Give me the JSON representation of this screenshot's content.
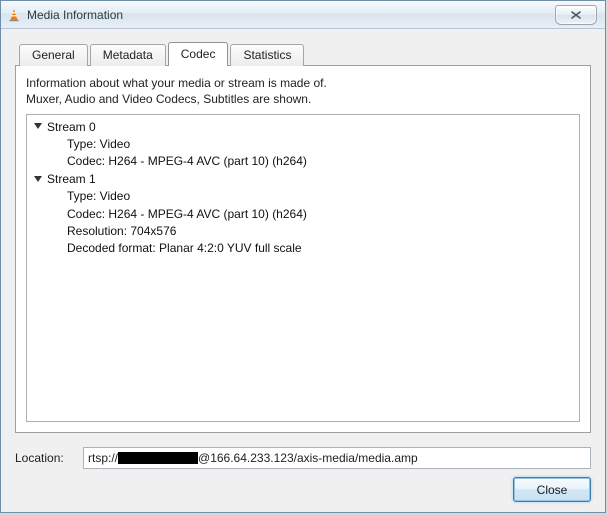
{
  "window": {
    "title": "Media Information"
  },
  "tabs": {
    "general": "General",
    "metadata": "Metadata",
    "codec": "Codec",
    "statistics": "Statistics",
    "active": "codec"
  },
  "panel": {
    "info_line1": "Information about what your media or stream is made of.",
    "info_line2": "Muxer, Audio and Video Codecs, Subtitles are shown."
  },
  "streams": [
    {
      "label": "Stream 0",
      "props": [
        "Type: Video",
        "Codec: H264 - MPEG-4 AVC (part 10) (h264)"
      ]
    },
    {
      "label": "Stream 1",
      "props": [
        "Type: Video",
        "Codec: H264 - MPEG-4 AVC (part 10) (h264)",
        "Resolution: 704x576",
        "Decoded format: Planar 4:2:0 YUV full scale"
      ]
    }
  ],
  "location": {
    "label": "Location:",
    "prefix": "rtsp://",
    "suffix": "@166.64.233.123/axis-media/media.amp"
  },
  "buttons": {
    "close": "Close"
  }
}
